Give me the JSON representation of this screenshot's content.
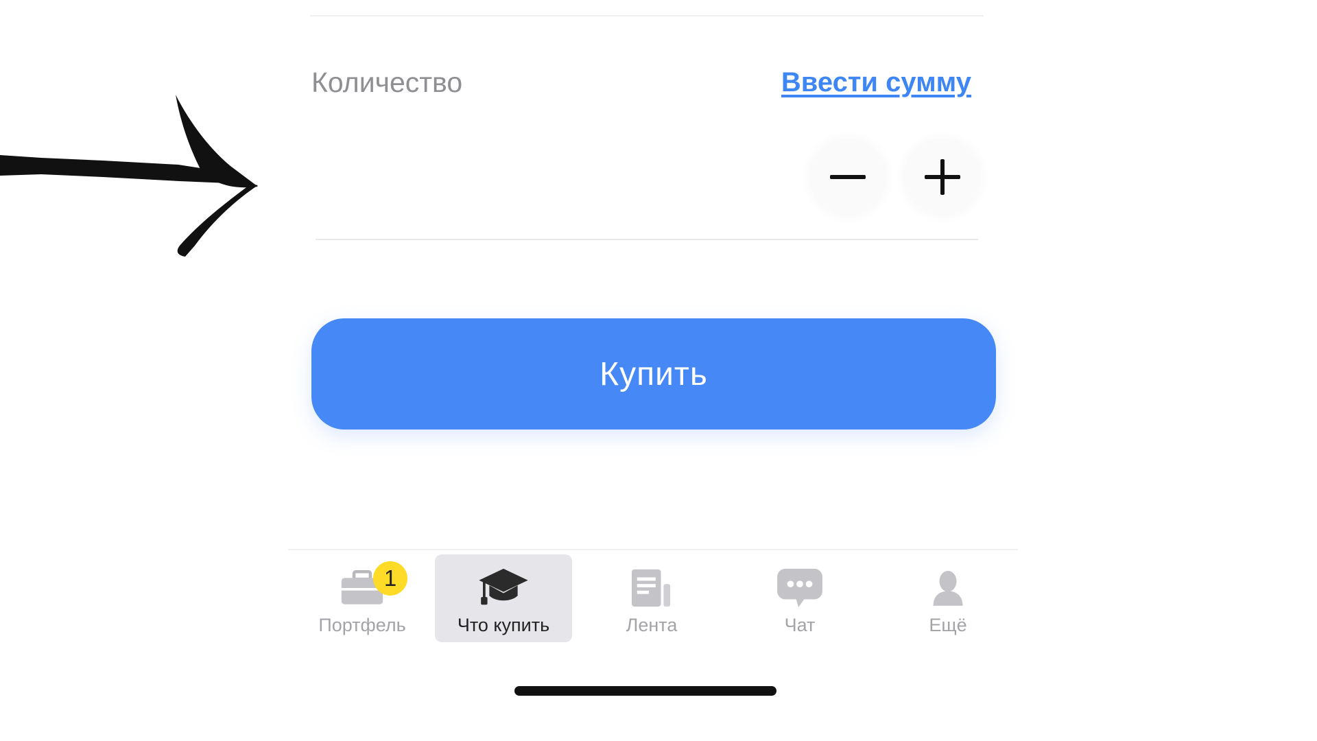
{
  "order": {
    "quantity_label": "Количество",
    "enter_sum_link": "Ввести сумму",
    "decrement_icon": "minus-icon",
    "increment_icon": "plus-icon",
    "buy_button_label": "Купить"
  },
  "tabbar": {
    "items": [
      {
        "label": "Портфель",
        "icon": "briefcase-icon",
        "badge": "1",
        "active": false
      },
      {
        "label": "Что купить",
        "icon": "graduation-cap-icon",
        "active": true
      },
      {
        "label": "Лента",
        "icon": "news-feed-icon",
        "active": false
      },
      {
        "label": "Чат",
        "icon": "chat-bubble-icon",
        "active": false
      },
      {
        "label": "Ещё",
        "icon": "profile-icon",
        "active": false
      }
    ]
  },
  "annotation": {
    "icon": "hand-drawn-arrow-icon"
  },
  "colors": {
    "accent": "#4689f6",
    "link": "#3d86f4",
    "badge": "#fddb26",
    "inactive_tab": "#a3a3a8"
  }
}
